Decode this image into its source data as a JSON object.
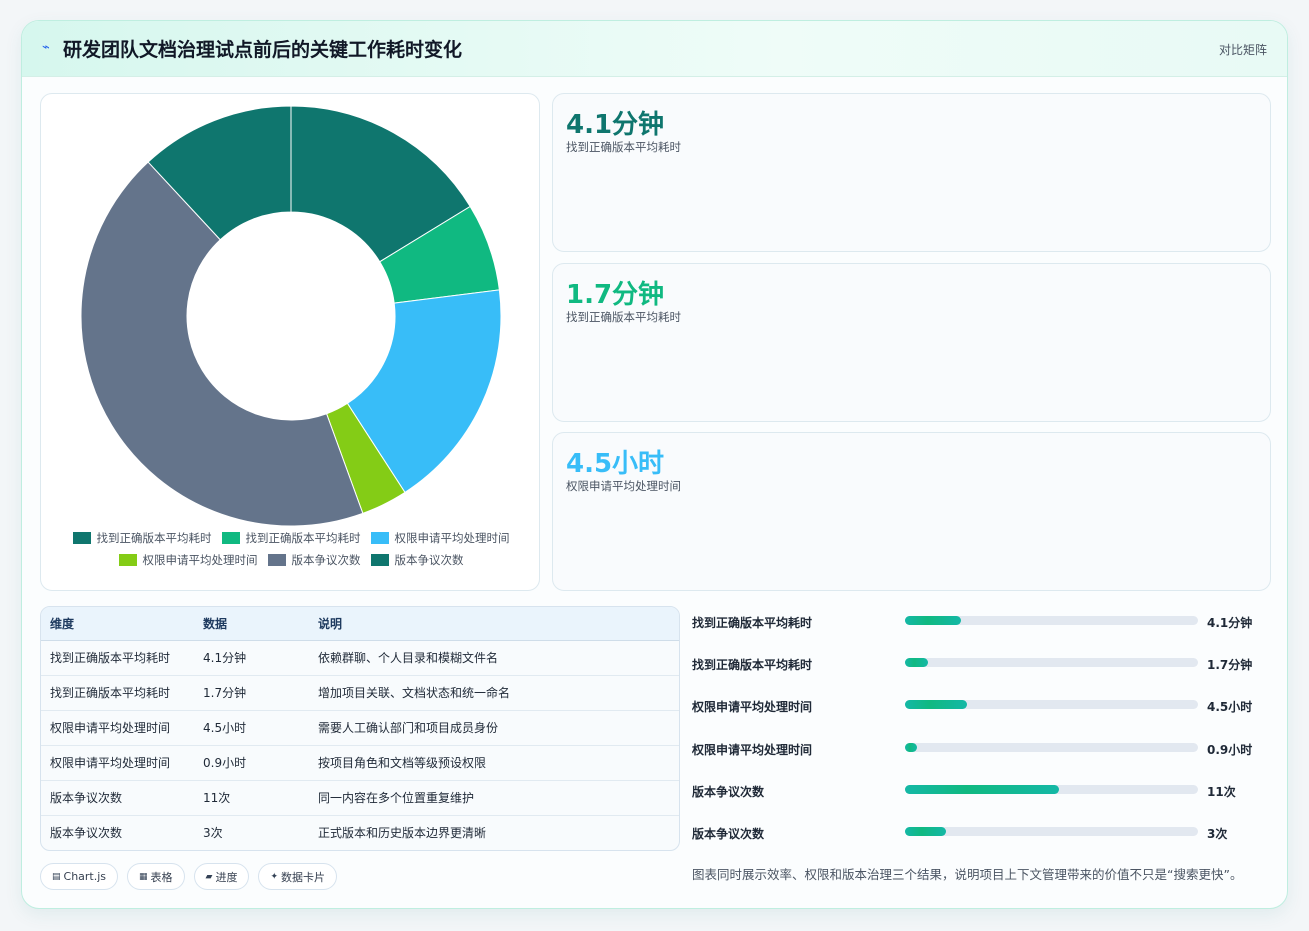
{
  "header": {
    "title": "研发团队文档治理试点前后的关键工作耗时变化",
    "tag": "对比矩阵",
    "icon": "bolt-icon"
  },
  "chart_data": {
    "type": "doughnut",
    "categories": [
      "找到正确版本平均耗时",
      "找到正确版本平均耗时",
      "权限申请平均处理时间",
      "权限申请平均处理时间",
      "版本争议次数",
      "版本争议次数"
    ],
    "values": [
      4.1,
      1.7,
      4.5,
      0.9,
      11,
      3
    ],
    "colors": [
      "#0f766e",
      "#10b981",
      "#38bdf8",
      "#84cc16",
      "#64748b",
      "#0f766e"
    ],
    "legend_position": "bottom"
  },
  "stats": [
    {
      "value": "4.1分钟",
      "label": "找到正确版本平均耗时",
      "color": "#0f766e"
    },
    {
      "value": "1.7分钟",
      "label": "找到正确版本平均耗时",
      "color": "#10b981"
    },
    {
      "value": "4.5小时",
      "label": "权限申请平均处理时间",
      "color": "#38bdf8"
    }
  ],
  "table": {
    "headers": [
      "维度",
      "数据",
      "说明"
    ],
    "rows": [
      [
        "找到正确版本平均耗时",
        "4.1分钟",
        "依赖群聊、个人目录和模糊文件名"
      ],
      [
        "找到正确版本平均耗时",
        "1.7分钟",
        "增加项目关联、文档状态和统一命名"
      ],
      [
        "权限申请平均处理时间",
        "4.5小时",
        "需要人工确认部门和项目成员身份"
      ],
      [
        "权限申请平均处理时间",
        "0.9小时",
        "按项目角色和文档等级预设权限"
      ],
      [
        "版本争议次数",
        "11次",
        "同一内容在多个位置重复维护"
      ],
      [
        "版本争议次数",
        "3次",
        "正式版本和历史版本边界更清晰"
      ]
    ]
  },
  "chips": [
    {
      "icon": "▤",
      "label": "Chart.js"
    },
    {
      "icon": "▦",
      "label": "表格"
    },
    {
      "icon": "▰",
      "label": "进度"
    },
    {
      "icon": "✦",
      "label": "数据卡片"
    }
  ],
  "progress": [
    {
      "label": "找到正确版本平均耗时",
      "value": "4.1分钟",
      "fraction": 0.19
    },
    {
      "label": "找到正确版本平均耗时",
      "value": "1.7分钟",
      "fraction": 0.08
    },
    {
      "label": "权限申请平均处理时间",
      "value": "4.5小时",
      "fraction": 0.21
    },
    {
      "label": "权限申请平均处理时间",
      "value": "0.9小时",
      "fraction": 0.04
    },
    {
      "label": "版本争议次数",
      "value": "11次",
      "fraction": 0.525
    },
    {
      "label": "版本争议次数",
      "value": "3次",
      "fraction": 0.14
    }
  ],
  "note": "图表同时展示效率、权限和版本治理三个结果，说明项目上下文管理带来的价值不只是“搜索更快”。"
}
